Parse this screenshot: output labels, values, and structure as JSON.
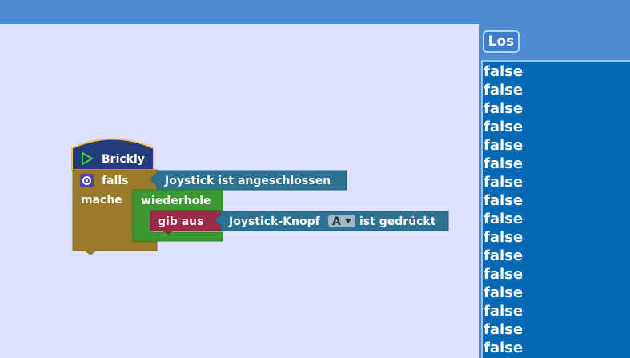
{
  "toolbar": {
    "run_label": "Los"
  },
  "blocks": {
    "start_label": "Brickly",
    "if_label": "falls",
    "do_label": "mache",
    "condition_label": "Joystick ist angeschlossen",
    "repeat_label": "wiederhole",
    "print_label": "gib aus",
    "button_pressed_prefix": "Joystick-Knopf",
    "button_option": "A",
    "button_pressed_suffix": "ist gedrückt",
    "colors": {
      "start": "#233b7d",
      "start_border": "#f2c14e",
      "control": "#9a7a2b",
      "sensor": "#2d7193",
      "loop": "#3a9931",
      "output": "#9c2b46",
      "workspace": "#dde2ff"
    }
  },
  "icons": {
    "start": "play-triangle-icon",
    "settings": "gear-icon",
    "dropdown": "chevron-down-icon"
  },
  "output": {
    "lines": [
      "false",
      "false",
      "false",
      "false",
      "false",
      "false",
      "false",
      "false",
      "false",
      "false",
      "false",
      "false",
      "false",
      "false",
      "false",
      "false"
    ]
  }
}
